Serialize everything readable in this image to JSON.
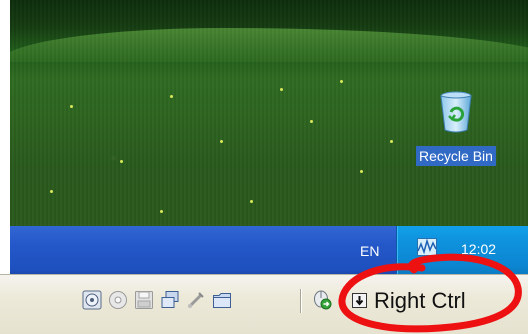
{
  "desktop": {
    "recycle_bin_label": "Recycle Bin"
  },
  "taskbar": {
    "language": "EN",
    "clock": "12:02"
  },
  "statusbar": {
    "icons": [
      "hard-disk-icon",
      "cd-dvd-icon",
      "floppy-icon",
      "network-icon",
      "usb-icon",
      "shared-folder-icon",
      "mouse-integration-icon",
      "host-key-arrow-icon"
    ],
    "host_key_label": "Right Ctrl"
  },
  "colors": {
    "taskbar_blue": "#2457c8",
    "tray_blue": "#0f93de",
    "selection_blue": "#316ac5",
    "statusbar_bg": "#ece9d8",
    "annotation_red": "#ee1111"
  }
}
